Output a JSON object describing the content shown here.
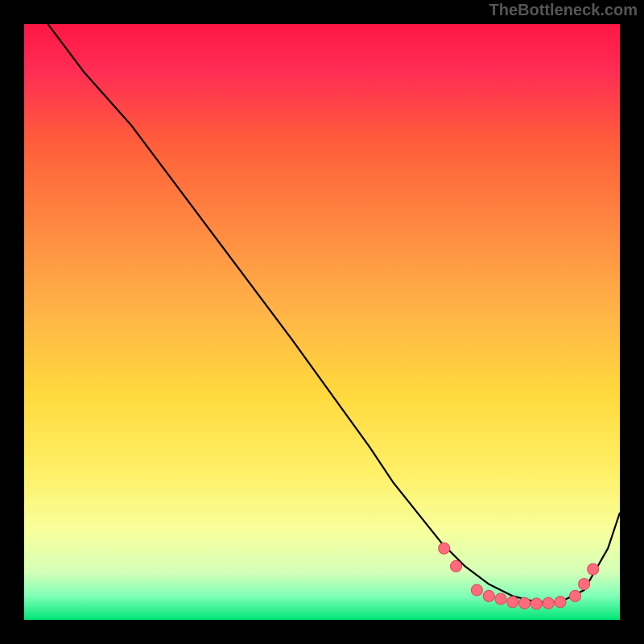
{
  "watermark": "TheBottleneck.com",
  "chart_data": {
    "type": "line",
    "title": "",
    "xlabel": "",
    "ylabel": "",
    "xlim": [
      0,
      100
    ],
    "ylim": [
      0,
      100
    ],
    "series": [
      {
        "name": "curve",
        "x": [
          4,
          10,
          18,
          30,
          45,
          58,
          62,
          66,
          70,
          74,
          78,
          82,
          86,
          90,
          94,
          98,
          100
        ],
        "y": [
          100,
          92,
          83,
          67,
          47,
          29,
          23,
          18,
          13,
          9,
          6,
          4,
          3,
          3,
          5,
          12,
          18
        ]
      }
    ],
    "markers": [
      {
        "x": 70.5,
        "y": 12
      },
      {
        "x": 72.5,
        "y": 9
      },
      {
        "x": 76,
        "y": 5
      },
      {
        "x": 78,
        "y": 4
      },
      {
        "x": 80,
        "y": 3.5
      },
      {
        "x": 82,
        "y": 3
      },
      {
        "x": 84,
        "y": 2.8
      },
      {
        "x": 86,
        "y": 2.7
      },
      {
        "x": 88,
        "y": 2.8
      },
      {
        "x": 90,
        "y": 3
      },
      {
        "x": 92.5,
        "y": 4
      },
      {
        "x": 94,
        "y": 6
      },
      {
        "x": 95.5,
        "y": 8.5
      }
    ]
  }
}
